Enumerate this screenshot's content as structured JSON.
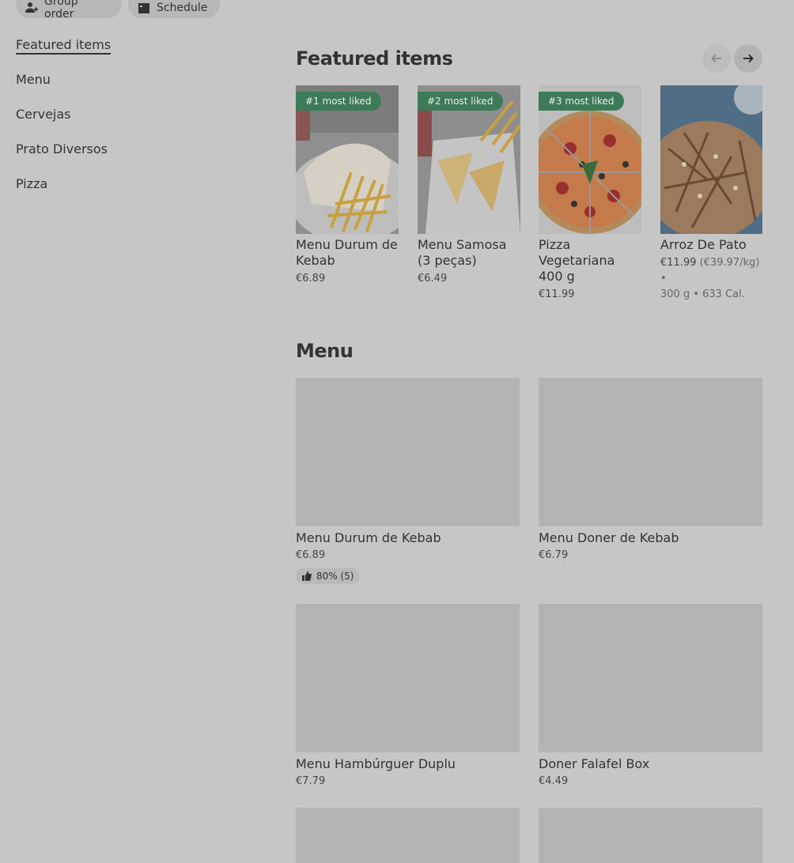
{
  "top_actions": {
    "group_order": "Group order",
    "schedule": "Schedule"
  },
  "sidebar": {
    "items": [
      {
        "label": "Featured items",
        "active": true
      },
      {
        "label": "Menu"
      },
      {
        "label": "Cervejas"
      },
      {
        "label": "Prato Diversos"
      },
      {
        "label": "Pizza"
      }
    ]
  },
  "featured": {
    "title": "Featured items",
    "items": [
      {
        "badge": "#1 most liked",
        "name": "Menu Durum de Kebab",
        "price": "€6.89"
      },
      {
        "badge": "#2 most liked",
        "name": "Menu Samosa (3 peças)",
        "price": "€6.49"
      },
      {
        "badge": "#3 most liked",
        "name": "Pizza Vegetariana 400 g",
        "price": "€11.99"
      },
      {
        "name": "Arroz De Pato",
        "price": "€11.99",
        "unit_price": " (€39.97/kg) •",
        "meta": "300 g • 633 Cal."
      }
    ]
  },
  "menu": {
    "title": "Menu",
    "items": [
      {
        "name": "Menu Durum de Kebab",
        "price": "€6.89",
        "rating": "80% (5)"
      },
      {
        "name": "Menu Doner de Kebab",
        "price": "€6.79"
      },
      {
        "name": "Menu Hambúrguer Duplu",
        "price": "€7.79"
      },
      {
        "name": "Doner Falafel Box",
        "price": "€4.49"
      }
    ]
  },
  "colors": {
    "badge_green": "#3d7a57",
    "overlay_grey": "#c6c6c6"
  }
}
